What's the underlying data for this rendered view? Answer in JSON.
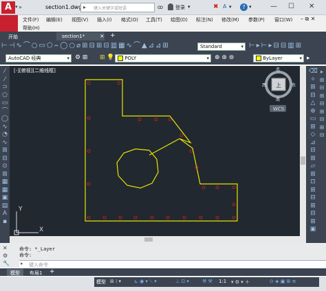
{
  "app": {
    "document_title": "section1.dwg",
    "search_placeholder": "键入关键字或短语",
    "login_label": "登录"
  },
  "menu": {
    "row1": [
      "文件(F)",
      "编辑(E)",
      "视图(V)",
      "插入(I)",
      "格式(O)",
      "工具(T)",
      "绘图(D)",
      "标注(N)",
      "修改(M)",
      "参数(P)",
      "窗口(W)"
    ],
    "row2": [
      "帮助(H)"
    ]
  },
  "doc_tabs": [
    "开始",
    "section1*"
  ],
  "toolbar": {
    "text_style": "Standard",
    "workspace": "AutoCAD 经典",
    "layer": "POLY",
    "color": "ByLayer"
  },
  "viewport": {
    "label": "[-][俯视][二维线框]",
    "viewcube_top": "北",
    "viewcube_bottom": "南",
    "viewcube_left": "西",
    "viewcube_right": "东",
    "viewcube_face": "上",
    "wcs": "WCS",
    "ucs_x": "X",
    "ucs_y": "Y"
  },
  "command": {
    "line1": "命令: *_Layer",
    "line2": "命令:",
    "input_placeholder": "键入命令"
  },
  "layout_tabs": [
    "模型",
    "布局1"
  ],
  "status": {
    "model": "模型",
    "scale": "1:1"
  }
}
